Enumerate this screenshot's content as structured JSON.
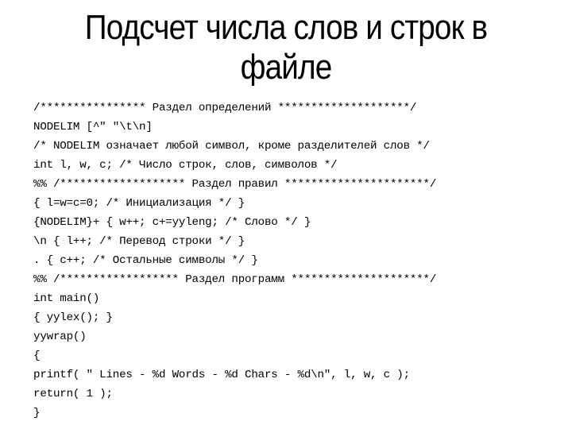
{
  "slide": {
    "title": "Подсчет числа слов и строк в файле",
    "code_lines": [
      "/**************** Раздел определений ********************/",
      "NODELIM [^\" \"\\t\\n]",
      "/* NODELIM означает любой символ, кроме разделителей слов */",
      "int l, w, c; /* Число строк, слов, символов */",
      "%% /******************* Раздел правил **********************/",
      "{ l=w=c=0; /* Инициализация */ }",
      "{NODELIM}+ { w++; c+=yyleng; /* Слово */ }",
      "\\n { l++; /* Перевод строки */ }",
      ". { c++; /* Остальные символы */ }",
      "%% /****************** Раздел программ *********************/",
      "int main()",
      "{ yylex(); }",
      "yywrap()",
      "{",
      "printf( \" Lines - %d Words - %d Chars - %d\\n\", l, w, c );",
      "return( 1 );",
      "}"
    ]
  }
}
